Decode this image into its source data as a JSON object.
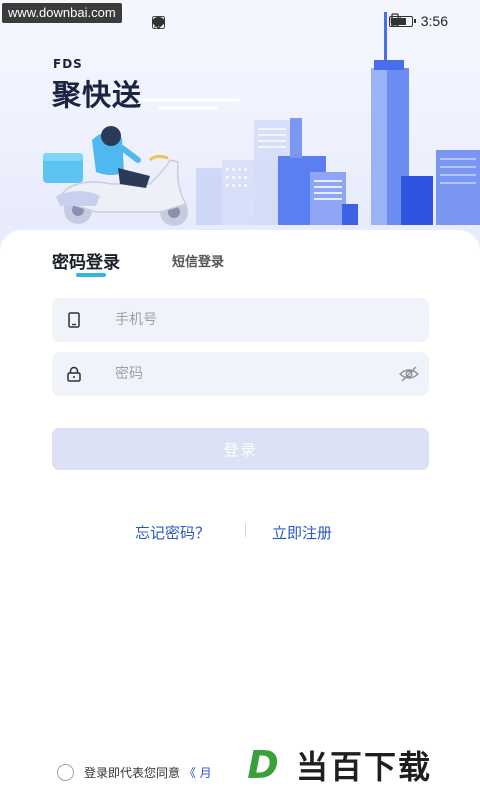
{
  "watermark_top": "www.downbai.com",
  "status": {
    "time": "3:56"
  },
  "brand": {
    "small": "FDS",
    "name": "聚快送"
  },
  "tabs": [
    {
      "label": "密码登录",
      "active": true
    },
    {
      "label": "短信登录",
      "active": false
    }
  ],
  "form": {
    "phone_placeholder": "手机号",
    "password_placeholder": "密码",
    "login_label": "登录"
  },
  "links": {
    "forgot": "忘记密码？",
    "register": "立即注册"
  },
  "agreement": {
    "text": "登录即代表您同意",
    "link": "《 月"
  },
  "watermark_brand": {
    "letter": "D",
    "text": "当百下载"
  },
  "colors": {
    "accent": "#2fb5e9",
    "link": "#2a56c6",
    "button_disabled": "#dde1f6",
    "field_bg": "#f1f3fa"
  }
}
